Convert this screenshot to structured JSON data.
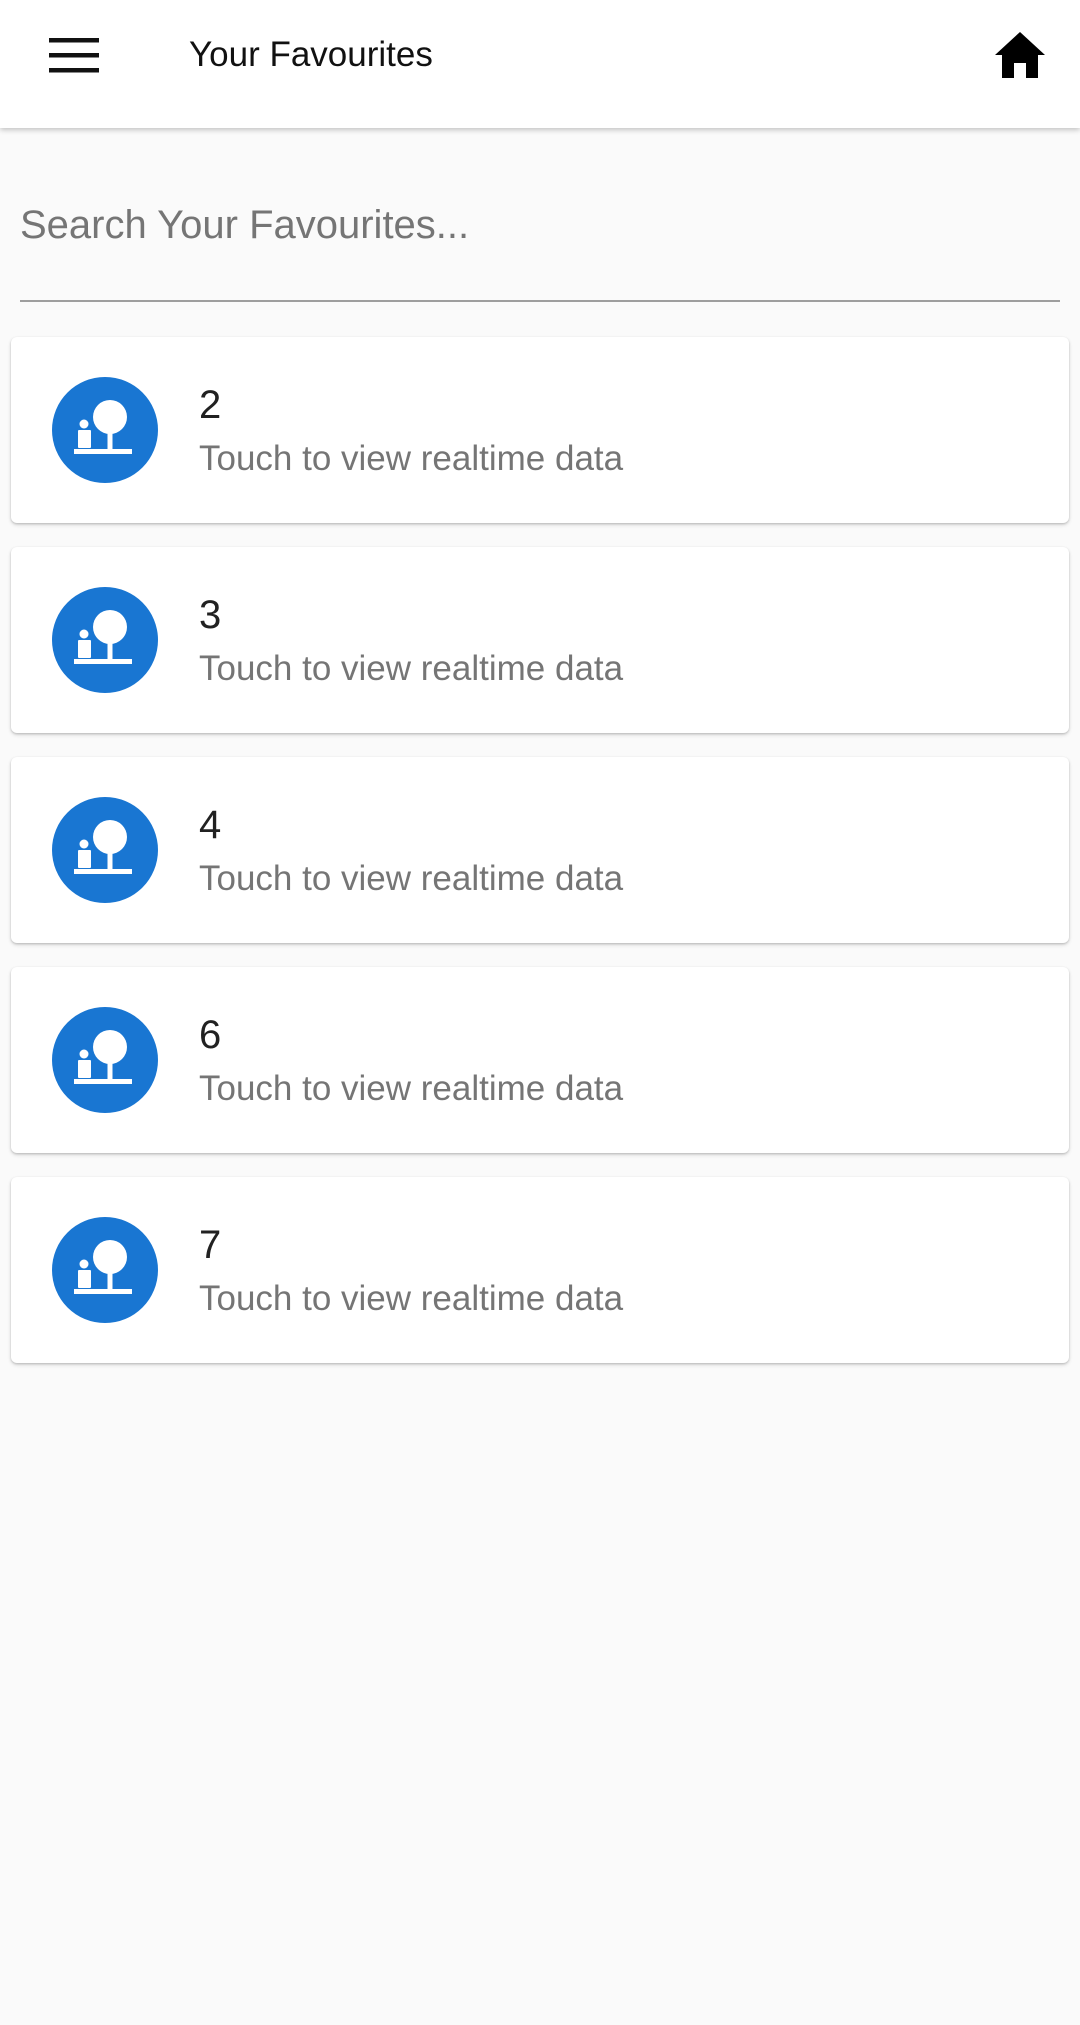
{
  "app_bar": {
    "title": "Your Favourites",
    "menu_icon": "menu-icon",
    "home_icon": "home-icon"
  },
  "search": {
    "placeholder": "Search Your Favourites...",
    "value": ""
  },
  "favourites": [
    {
      "title": "2",
      "subtitle": "Touch to view realtime data",
      "icon": "tree-sensor-icon"
    },
    {
      "title": "3",
      "subtitle": "Touch to view realtime data",
      "icon": "tree-sensor-icon"
    },
    {
      "title": "4",
      "subtitle": "Touch to view realtime data",
      "icon": "tree-sensor-icon"
    },
    {
      "title": "6",
      "subtitle": "Touch to view realtime data",
      "icon": "tree-sensor-icon"
    },
    {
      "title": "7",
      "subtitle": "Touch to view realtime data",
      "icon": "tree-sensor-icon"
    }
  ],
  "colors": {
    "accent": "#1976d2",
    "background": "#fafafa",
    "app_bar": "#ffffff"
  }
}
